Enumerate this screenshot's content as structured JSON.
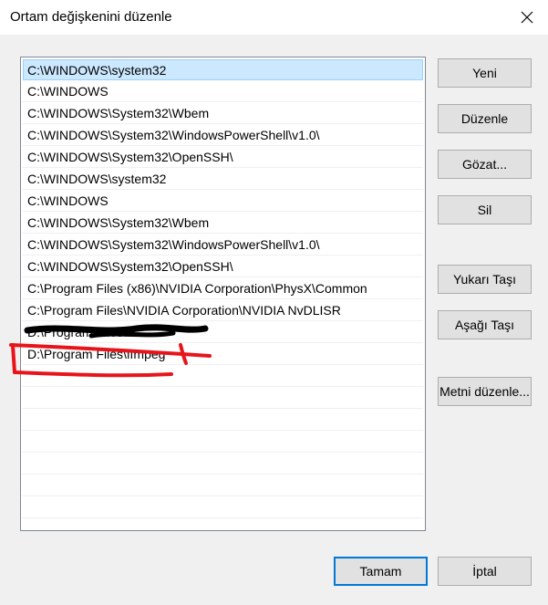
{
  "window": {
    "title": "Ortam değişkenini düzenle"
  },
  "icons": {
    "close": "close-icon"
  },
  "paths": [
    "C:\\WINDOWS\\system32",
    "C:\\WINDOWS",
    "C:\\WINDOWS\\System32\\Wbem",
    "C:\\WINDOWS\\System32\\WindowsPowerShell\\v1.0\\",
    "C:\\WINDOWS\\System32\\OpenSSH\\",
    "C:\\WINDOWS\\system32",
    "C:\\WINDOWS",
    "C:\\WINDOWS\\System32\\Wbem",
    "C:\\WINDOWS\\System32\\WindowsPowerShell\\v1.0\\",
    "C:\\WINDOWS\\System32\\OpenSSH\\",
    "C:\\Program Files (x86)\\NVIDIA Corporation\\PhysX\\Common",
    "C:\\Program Files\\NVIDIA Corporation\\NVIDIA NvDLISR",
    "D:\\Program Files\\...",
    "D:\\Program Files\\ffmpeg"
  ],
  "buttons": {
    "new": "Yeni",
    "edit": "Düzenle",
    "browse": "Gözat...",
    "delete": "Sil",
    "move_up": "Yukarı Taşı",
    "move_down": "Aşağı Taşı",
    "edit_text": "Metni düzenle...",
    "ok": "Tamam",
    "cancel": "İptal"
  },
  "colors": {
    "selection_bg": "#cce8ff",
    "selection_border": "#99d1ff",
    "default_button_border": "#0078d7",
    "annotation": "#e8141c"
  }
}
